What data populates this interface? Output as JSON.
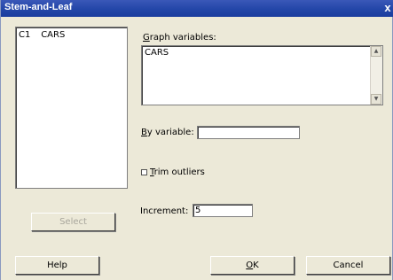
{
  "window": {
    "title": "Stem-and-Leaf",
    "close_glyph": "x"
  },
  "variables": [
    {
      "column": "C1",
      "name": "CARS"
    }
  ],
  "graph_variables": {
    "label_underline": "G",
    "label_rest": "raph variables:",
    "value": "CARS"
  },
  "by_variable": {
    "label_underline": "B",
    "label_rest": "y variable:",
    "value": ""
  },
  "trim_outliers": {
    "label_underline": "T",
    "label_rest": "rim outliers",
    "checked": false
  },
  "increment": {
    "label": "Increment:",
    "value": "5"
  },
  "buttons": {
    "select": "Select",
    "help": "Help",
    "ok_underline": "O",
    "ok_rest": "K",
    "cancel": "Cancel"
  }
}
